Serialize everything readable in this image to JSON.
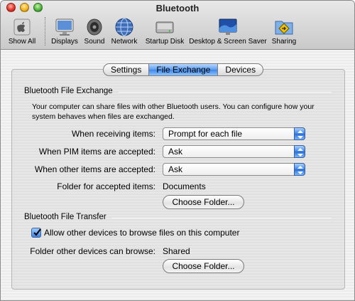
{
  "window": {
    "title": "Bluetooth"
  },
  "toolbar": {
    "items": [
      {
        "label": "Show All",
        "icon": "show-all-icon"
      },
      {
        "label": "Displays",
        "icon": "displays-icon"
      },
      {
        "label": "Sound",
        "icon": "sound-icon"
      },
      {
        "label": "Network",
        "icon": "network-icon"
      },
      {
        "label": "Startup Disk",
        "icon": "startup-disk-icon"
      },
      {
        "label": "Desktop & Screen Saver",
        "icon": "desktop-screen-saver-icon"
      },
      {
        "label": "Sharing",
        "icon": "sharing-icon"
      }
    ]
  },
  "tabs": [
    {
      "label": "Settings",
      "selected": false
    },
    {
      "label": "File Exchange",
      "selected": true
    },
    {
      "label": "Devices",
      "selected": false
    }
  ],
  "file_exchange": {
    "section_title": "Bluetooth File Exchange",
    "description": "Your computer can share files with other Bluetooth users. You can configure how your system behaves when files are exchanged.",
    "receiving": {
      "label": "When receiving items:",
      "value": "Prompt for each file"
    },
    "pim": {
      "label": "When PIM items are accepted:",
      "value": "Ask"
    },
    "other": {
      "label": "When other items are accepted:",
      "value": "Ask"
    },
    "folder": {
      "label": "Folder for accepted items:",
      "value": "Documents"
    },
    "choose_folder": "Choose Folder..."
  },
  "file_transfer": {
    "section_title": "Bluetooth File Transfer",
    "allow_browse": {
      "label": "Allow other devices to browse files on this computer",
      "checked": true
    },
    "browse_folder": {
      "label": "Folder other devices can browse:",
      "value": "Shared"
    },
    "choose_folder": "Choose Folder..."
  },
  "colors": {
    "accent": "#3f87e6",
    "window_bg": "#ececec"
  }
}
